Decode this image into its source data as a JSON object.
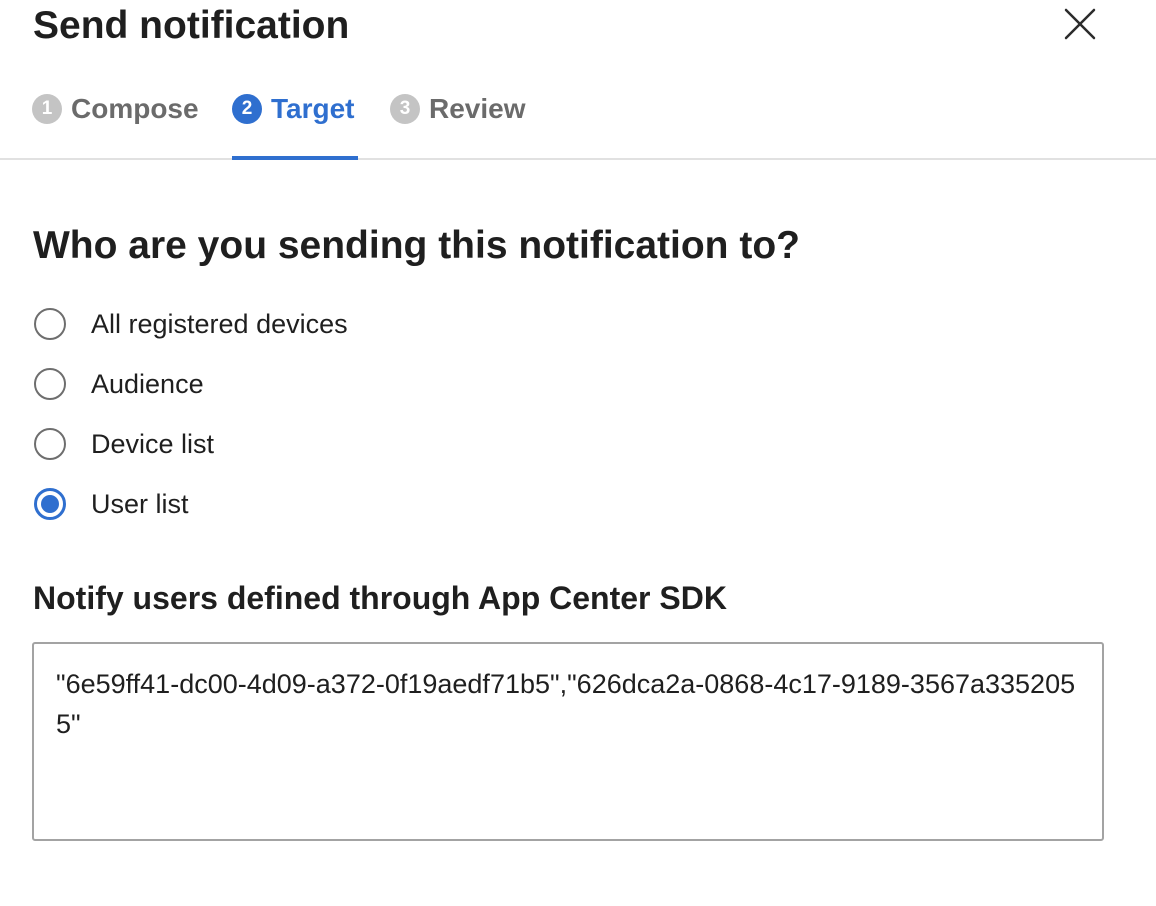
{
  "dialog": {
    "title": "Send notification",
    "close_icon": "close-icon"
  },
  "steps": [
    {
      "number": "1",
      "label": "Compose",
      "state": "inactive"
    },
    {
      "number": "2",
      "label": "Target",
      "state": "active"
    },
    {
      "number": "3",
      "label": "Review",
      "state": "inactive"
    }
  ],
  "target": {
    "question": "Who are you sending this notification to?",
    "options": [
      {
        "label": "All registered devices",
        "selected": false
      },
      {
        "label": "Audience",
        "selected": false
      },
      {
        "label": "Device list",
        "selected": false
      },
      {
        "label": "User list",
        "selected": true
      }
    ],
    "user_list_label": "Notify users defined through App Center SDK",
    "user_list_value": "\"6e59ff41-dc00-4d09-a372-0f19aedf71b5\",\"626dca2a-0868-4c17-9189-3567a3352055\""
  },
  "colors": {
    "accent": "#2f6fcf",
    "inactive_step": "#c4c4c4",
    "inactive_text": "#6b6b6b"
  }
}
